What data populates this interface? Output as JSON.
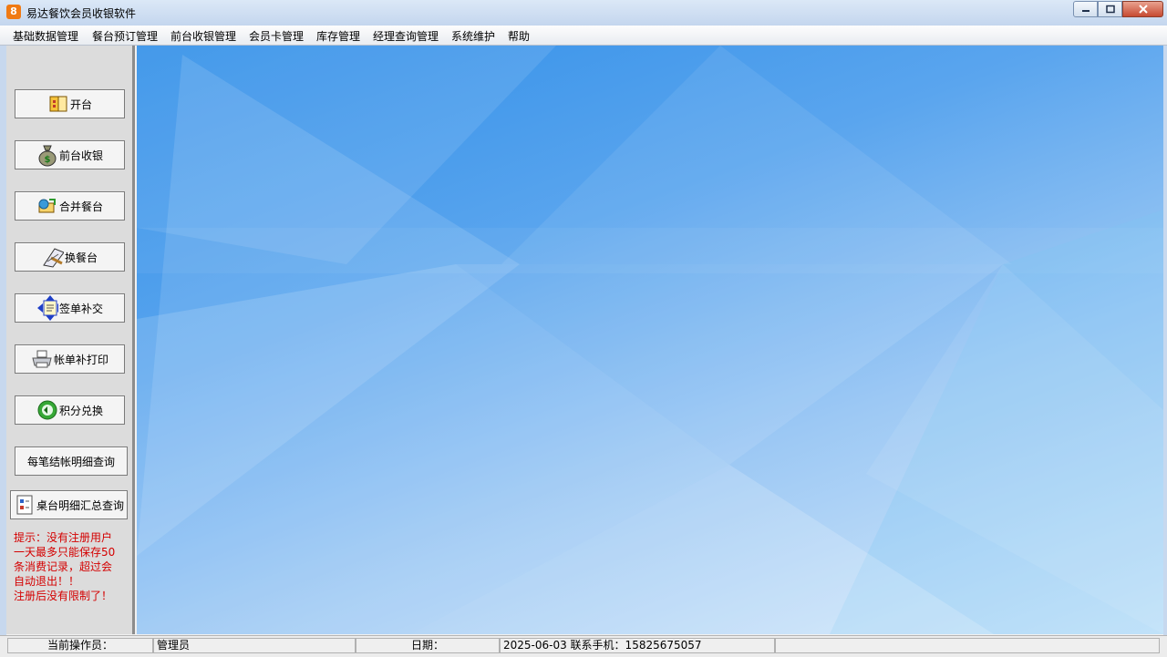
{
  "window": {
    "title": "易达餐饮会员收银软件",
    "icon_glyph": "8"
  },
  "menu": [
    {
      "label": "基础数据管理"
    },
    {
      "label": "餐台预订管理"
    },
    {
      "label": "前台收银管理"
    },
    {
      "label": "会员卡管理"
    },
    {
      "label": "库存管理"
    },
    {
      "label": "经理查询管理"
    },
    {
      "label": "系统维护"
    },
    {
      "label": "帮助"
    }
  ],
  "sidebar": {
    "buttons": [
      {
        "label": "开台",
        "icon": "table-open-icon"
      },
      {
        "label": "前台收银",
        "icon": "money-bag-icon"
      },
      {
        "label": "合并餐台",
        "icon": "merge-table-icon"
      },
      {
        "label": "换餐台",
        "icon": "change-table-icon"
      },
      {
        "label": "签单补交",
        "icon": "sign-bill-icon"
      },
      {
        "label": "帐单补打印",
        "icon": "printer-icon"
      },
      {
        "label": "积分兑换",
        "icon": "points-exchange-icon"
      },
      {
        "label": "每笔结帐明细查询",
        "icon": ""
      },
      {
        "label": "桌台明细汇总查询",
        "icon": "report-icon"
      }
    ],
    "hint_lines": [
      "提示：没有注册用户",
      "一天最多只能保存50",
      "条消费记录，超过会",
      "自动退出！！",
      "注册后没有限制了！"
    ]
  },
  "status": {
    "operator_label": "当前操作员：",
    "operator_value": "管理员",
    "date_label": "日期：",
    "date_value": "2025-06-03  联系手机：15825675057",
    "extra": ""
  },
  "colors": {
    "hint_text": "#d40000",
    "bg_top": "#2f8ee8",
    "bg_bottom": "#d8ebfb"
  }
}
